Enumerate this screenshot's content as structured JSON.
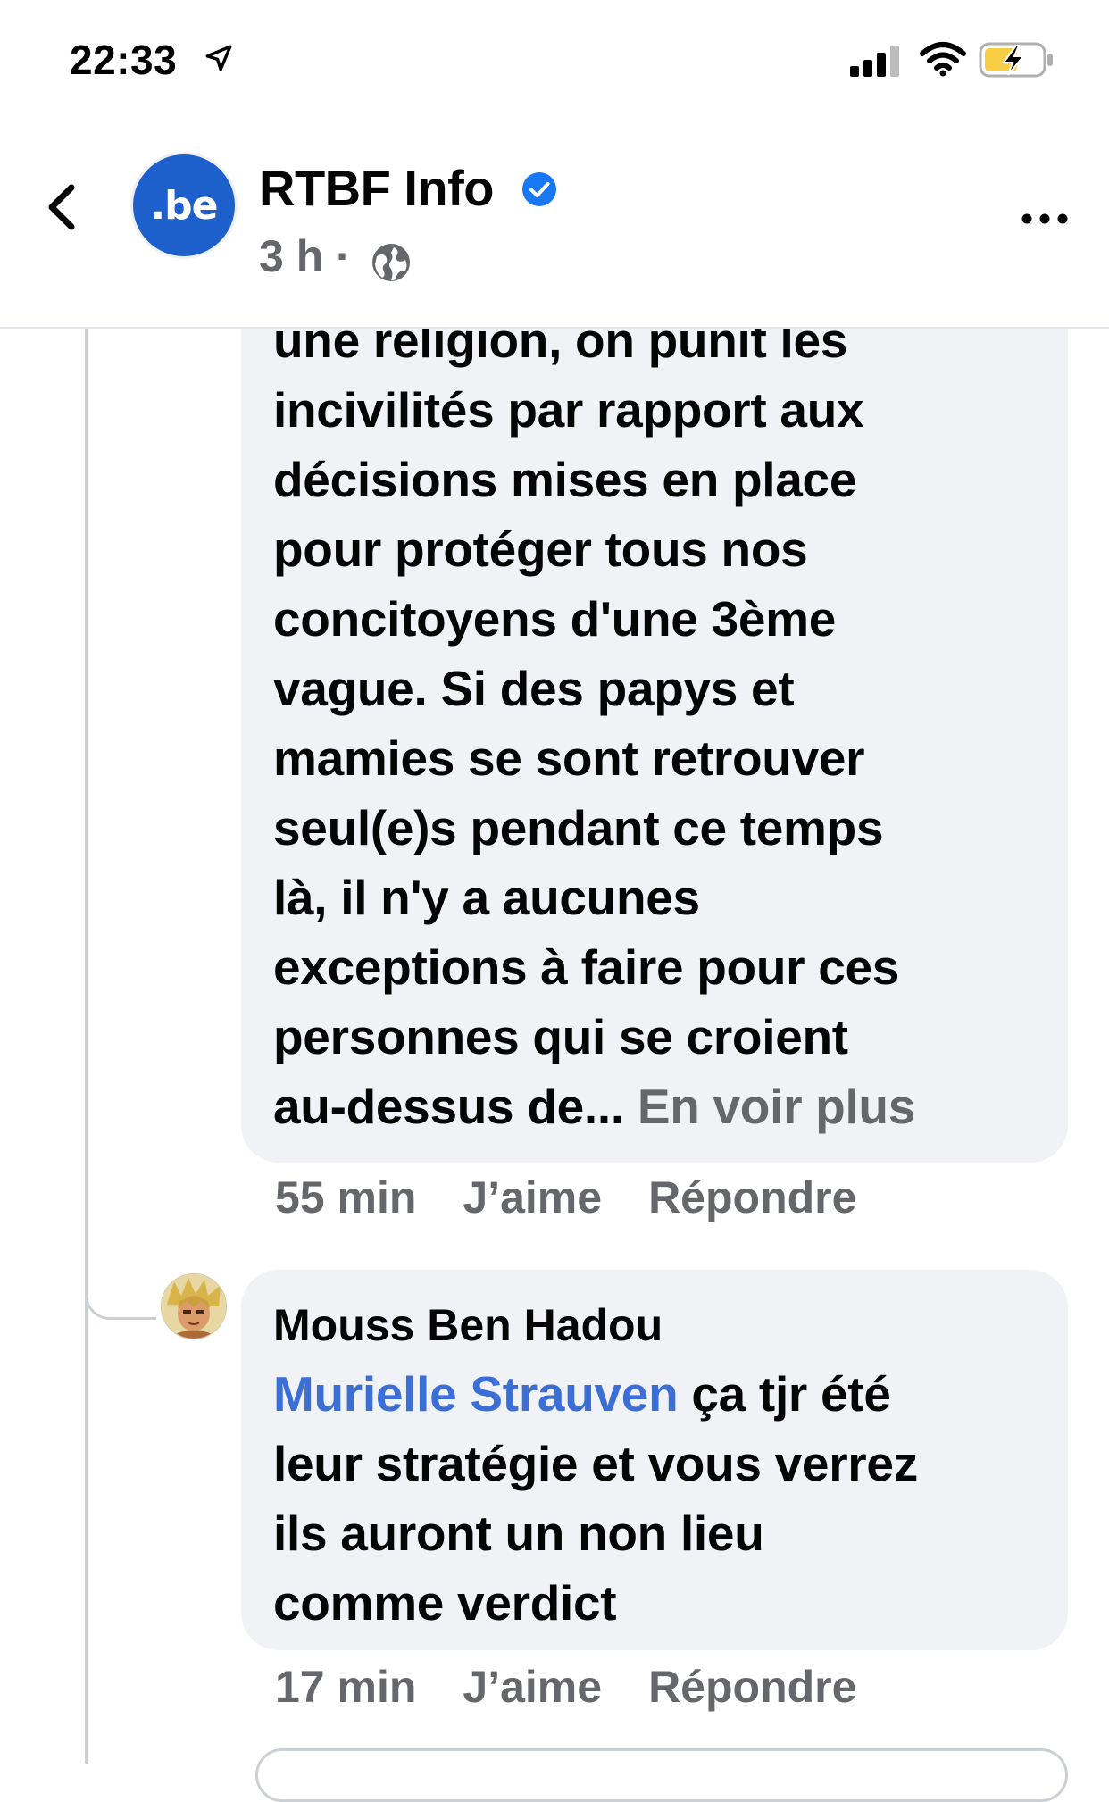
{
  "status_bar": {
    "time": "22:33"
  },
  "header": {
    "page_name": "RTBF Info",
    "avatar_text": ".be",
    "post_time": "3 h ·"
  },
  "comments": [
    {
      "text": "une religion, on punit les\nincivilités par rapport aux\ndécisions mises en place\npour protéger tous nos\nconcitoyens d'une 3ème\nvague. Si des papys et\nmamies se sont retrouver\nseul(e)s pendant ce temps\nlà, il n'y a aucunes\nexceptions à faire pour ces\npersonnes qui se croient\nau-dessus de... ",
      "see_more": "En voir plus",
      "time": "55 min",
      "like": "J’aime",
      "reply": "Répondre"
    },
    {
      "author": "Mouss Ben Hadou",
      "mention": "Murielle Strauven",
      "text": " ça tjr été\nleur stratégie et vous verrez\nils auront un non lieu\ncomme verdict",
      "time": "17 min",
      "like": "J’aime",
      "reply": "Répondre"
    }
  ],
  "colors": {
    "verified_blue": "#1877f2",
    "mention_blue": "#3b6fd6",
    "secondary_text": "#65676b",
    "bubble_bg": "#f0f2f5",
    "avatar_blue": "#1d5fcb"
  }
}
